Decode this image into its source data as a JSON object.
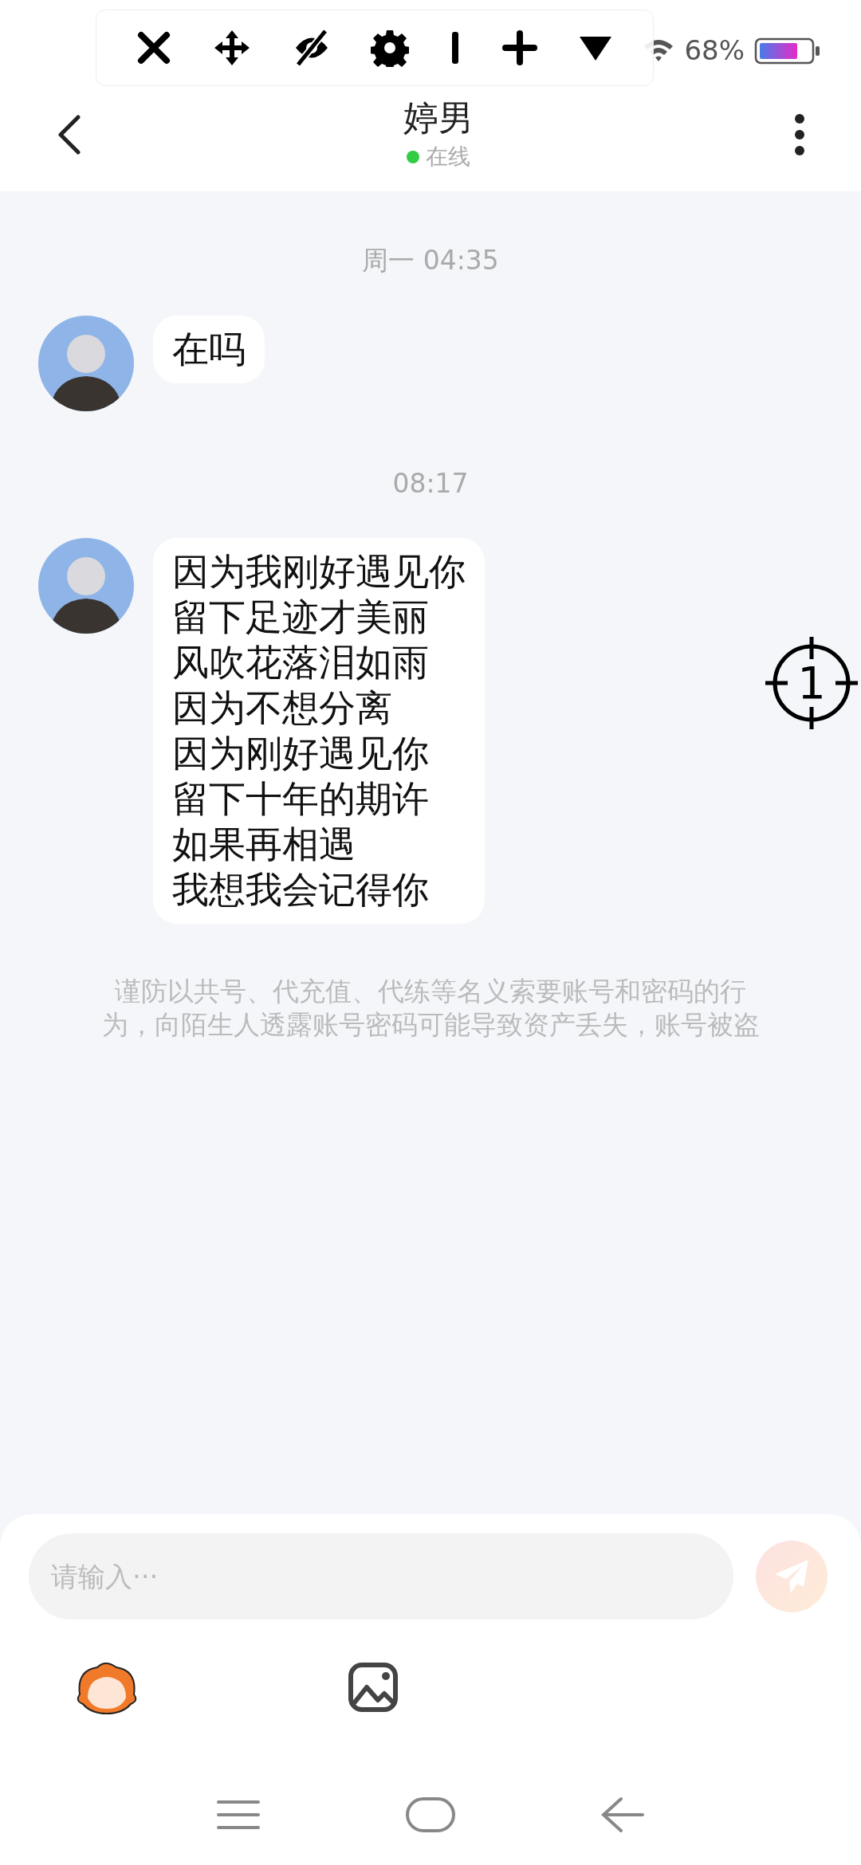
{
  "status_bar": {
    "battery": "68%"
  },
  "header": {
    "title": "婷男",
    "status": "在线",
    "online": true
  },
  "messages": [
    {
      "kind": "time",
      "text": "周一 04:35"
    },
    {
      "kind": "message",
      "lines": [
        "在吗"
      ]
    },
    {
      "kind": "time",
      "text": "08:17"
    },
    {
      "kind": "message",
      "lines": [
        "因为我刚好遇见你",
        "留下足迹才美丽",
        "风吹花落泪如雨",
        "因为不想分离",
        "因为刚好遇见你",
        "留下十年的期许",
        "如果再相遇",
        "我想我会记得你"
      ]
    }
  ],
  "notice": "谨防以共号、代充值、代练等名义索要账号和密码的行为，向陌生人透露账号密码可能导致资产丢失，账号被盗",
  "marker": {
    "label": "1"
  },
  "composer": {
    "placeholder": "请输入···",
    "send_disabled": true
  }
}
